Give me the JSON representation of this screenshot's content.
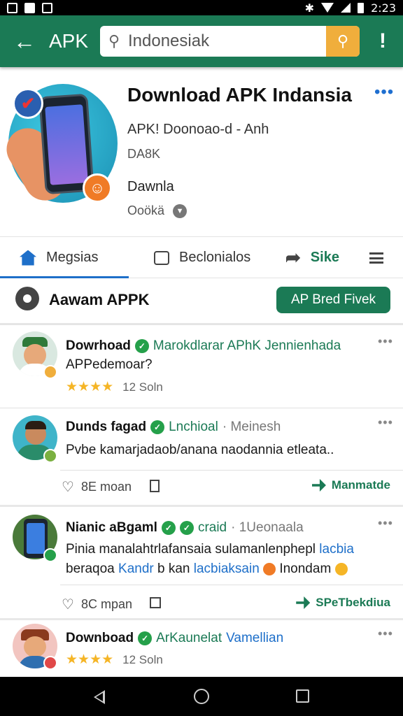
{
  "status_bar": {
    "time": "2:23"
  },
  "app_bar": {
    "title": "APK",
    "search_value": "Indonesiak",
    "icons": [
      "back-arrow-icon",
      "search-icon",
      "more-vert-icon"
    ]
  },
  "hero": {
    "title": "Download APK Indansia",
    "subtitle": "APK! Doonoao-d - Anh",
    "size": "DA8K",
    "developer": "Dawnla",
    "count": "Ooökä"
  },
  "tabs": [
    {
      "label": "Megsias",
      "icon": "home-icon"
    },
    {
      "label": "Beclonialos",
      "icon": "chat-icon"
    },
    {
      "label": "Sike",
      "icon": "share-icon"
    }
  ],
  "action_row": {
    "label": "Aawam APPK",
    "button": "AP Bred Fivek"
  },
  "posts": [
    {
      "name": "Dowrhoad",
      "head_green": "Marokdlarar APhK Jennienhada",
      "text": "APPedemoar?",
      "stars": "★★★★",
      "rating_count": "12 Soln"
    },
    {
      "name": "Dunds fagad",
      "head_green": "Lnchioal",
      "head_gray": "· Meinesh",
      "text": "Pvbe kamarjadaob/anana naodannia etleata..",
      "likes": "8E moan",
      "right_action": "Manmatde"
    },
    {
      "name": "Nianic aBgaml",
      "head_green": "craid",
      "head_gray": "· 1Ueonaala",
      "text_line1_a": "Pinia manalahtrlafansaia sulamanlenphepl",
      "text_line1_b": "lacbia",
      "text_line2_a": "beraqoa",
      "text_line2_b": "Kandr",
      "text_line2_c": "b kan",
      "text_line2_d": "lacbiaksain",
      "text_line2_e": "Inondam",
      "likes": "8C mpan",
      "right_action": "SPeTbekdiua"
    },
    {
      "name": "Downboad",
      "head_green": "ArKaunelat",
      "head_blue": "Vamellian",
      "stars": "★★★★",
      "rating_count": "12 Soln"
    }
  ],
  "colors": {
    "brand": "#1b7a55",
    "accent": "#f0ae3c",
    "link": "#1e6fc9"
  }
}
